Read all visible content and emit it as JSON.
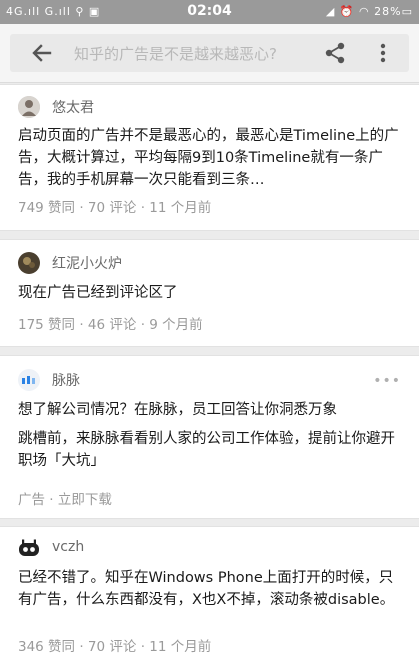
{
  "status_bar": {
    "left": "4G.ıll G.ıll ⚲ ▣",
    "time": "02:04",
    "right": "◢ ⏰ ◠ 28%▭"
  },
  "search": {
    "query": "知乎的广告是不是越来越恶心?"
  },
  "icons": {
    "back": "arrow-left",
    "share": "share",
    "more": "more-vertical"
  },
  "answers": [
    {
      "author": "悠太君",
      "text": "启动页面的广告并不是最恶心的，最恶心是Timeline上的广告，大概计算过，平均每隔9到10条Timeline就有一条广告，我的手机屏幕一次只能看到三条…",
      "meta": "749 赞同 · 70 评论 · 11 个月前"
    },
    {
      "author": "红泥小火炉",
      "text": "现在广告已经到评论区了",
      "meta": "175 赞同 · 46 评论 · 9 个月前"
    }
  ],
  "ad": {
    "author": "脉脉",
    "text1": "想了解公司情况？在脉脉，员工回答让你洞悉万象",
    "text2": "跳槽前，来脉脉看看别人家的公司工作体验，提前让你避开职场「大坑」",
    "meta": "广告 · 立即下载",
    "more": "•••"
  },
  "answer3": {
    "author": "vczh",
    "text": "已经不错了。知乎在Windows Phone上面打开的时候，只有广告，什么东西都没有，X也X不掉，滚动条被disable。",
    "meta": "346 赞同 · 70 评论 · 11 个月前"
  }
}
